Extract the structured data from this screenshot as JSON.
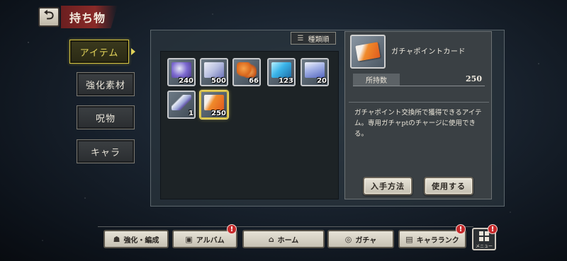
{
  "header": {
    "back_icon": "back-arrow-icon",
    "title": "持ち物"
  },
  "tabs": [
    {
      "label": "アイテム",
      "active": true
    },
    {
      "label": "強化素材",
      "active": false
    },
    {
      "label": "呪物",
      "active": false
    },
    {
      "label": "キャラ",
      "active": false
    }
  ],
  "sort": {
    "icon": "sort-icon",
    "label": "種類順"
  },
  "items": [
    {
      "name": "bottle-item",
      "count": "240"
    },
    {
      "name": "cards-item",
      "count": "500"
    },
    {
      "name": "leaves-item",
      "count": "66"
    },
    {
      "name": "cylinder-item",
      "count": "123"
    },
    {
      "name": "ticket-item",
      "count": "20"
    },
    {
      "name": "tube-item",
      "count": "1"
    },
    {
      "name": "gacha-point-card-item",
      "count": "250",
      "selected": true
    }
  ],
  "detail": {
    "name": "ガチャポイントカード",
    "qty_label": "所持数",
    "qty_value": "250",
    "description": "ガチャポイント交換所で獲得できるアイテム。専用ガチャptのチャージに使用できる。",
    "acquire_button": "入手方法",
    "use_button": "使用する"
  },
  "nav": [
    {
      "label": "強化・編成",
      "icon": "team-icon",
      "badge": false
    },
    {
      "label": "アルバム",
      "icon": "album-icon",
      "badge": true
    },
    {
      "label": "ホーム",
      "icon": "home-icon",
      "badge": false
    },
    {
      "label": "ガチャ",
      "icon": "gacha-icon",
      "badge": false
    },
    {
      "label": "キャラランク",
      "icon": "character-rank-icon",
      "badge": true
    }
  ],
  "menu": {
    "label": "メニュー",
    "badge": true
  },
  "badge_symbol": "!",
  "colors": {
    "accent_active": "#d4c340",
    "badge": "#c6282a",
    "title_banner": "#8a2a28"
  }
}
